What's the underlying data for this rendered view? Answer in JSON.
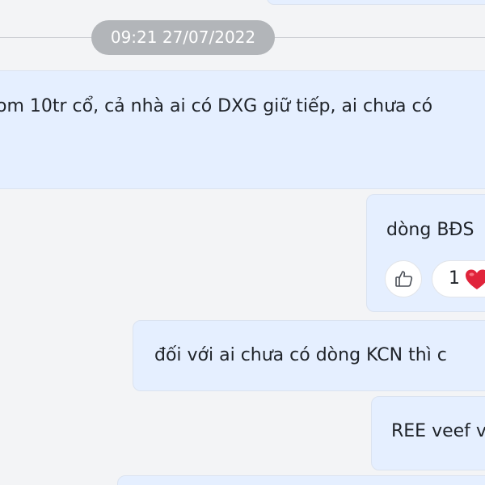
{
  "separator": {
    "timestamp": "09:21 27/07/2022"
  },
  "messages": [
    {
      "text": "om 10tr cổ, cả nhà ai có DXG giữ tiếp, ai chưa có"
    },
    {
      "text": "dòng BĐS",
      "reactions": {
        "count": "1",
        "emoji": "heart"
      }
    },
    {
      "text": "đối với ai chưa có dòng KCN thì c"
    },
    {
      "text": "REE veef v"
    }
  ],
  "icons": {
    "like": "thumbs-up-icon",
    "reaction": "red-heart-icon"
  },
  "colors": {
    "background": "#f3f4f6",
    "bubble": "#e5efff",
    "timestamp_pill": "#b2b5b9",
    "heart": "#e0243b"
  }
}
